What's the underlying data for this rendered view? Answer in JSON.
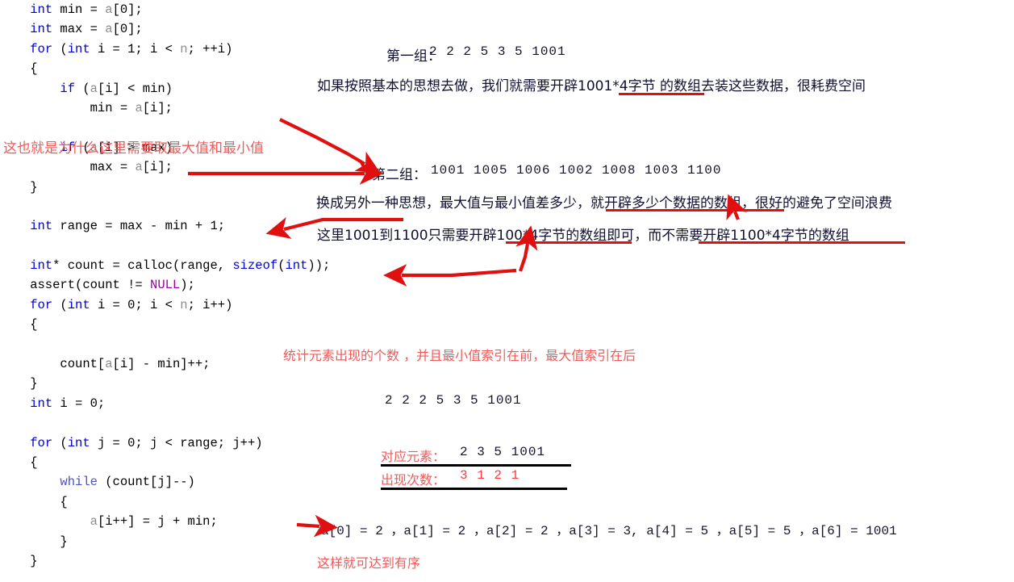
{
  "code": {
    "lines": [
      [
        {
          "t": "    ",
          "c": "plain"
        },
        {
          "t": "int",
          "c": "kw"
        },
        {
          "t": " min = ",
          "c": "plain"
        },
        {
          "t": "a",
          "c": "var"
        },
        {
          "t": "[0];",
          "c": "plain"
        }
      ],
      [
        {
          "t": "    ",
          "c": "plain"
        },
        {
          "t": "int",
          "c": "kw"
        },
        {
          "t": " max = ",
          "c": "plain"
        },
        {
          "t": "a",
          "c": "var"
        },
        {
          "t": "[0];",
          "c": "plain"
        }
      ],
      [
        {
          "t": "    ",
          "c": "plain"
        },
        {
          "t": "for",
          "c": "kw"
        },
        {
          "t": " (",
          "c": "plain"
        },
        {
          "t": "int",
          "c": "kw"
        },
        {
          "t": " i = 1; i < ",
          "c": "plain"
        },
        {
          "t": "n",
          "c": "var"
        },
        {
          "t": "; ++i)",
          "c": "plain"
        }
      ],
      [
        {
          "t": "    {",
          "c": "plain"
        }
      ],
      [
        {
          "t": "        ",
          "c": "plain"
        },
        {
          "t": "if",
          "c": "kw"
        },
        {
          "t": " (",
          "c": "plain"
        },
        {
          "t": "a",
          "c": "var"
        },
        {
          "t": "[i] < min)",
          "c": "plain"
        }
      ],
      [
        {
          "t": "            min = ",
          "c": "plain"
        },
        {
          "t": "a",
          "c": "var"
        },
        {
          "t": "[i];",
          "c": "plain"
        }
      ],
      [
        {
          "t": "",
          "c": "plain"
        }
      ],
      [
        {
          "t": "        ",
          "c": "plain"
        },
        {
          "t": "if",
          "c": "kw"
        },
        {
          "t": " (",
          "c": "plain"
        },
        {
          "t": "a",
          "c": "var"
        },
        {
          "t": "[i] > max)",
          "c": "plain"
        }
      ],
      [
        {
          "t": "            max = ",
          "c": "plain"
        },
        {
          "t": "a",
          "c": "var"
        },
        {
          "t": "[i];",
          "c": "plain"
        }
      ],
      [
        {
          "t": "    }",
          "c": "plain"
        }
      ],
      [
        {
          "t": "",
          "c": "plain"
        }
      ],
      [
        {
          "t": "    ",
          "c": "plain"
        },
        {
          "t": "int",
          "c": "kw"
        },
        {
          "t": " range = max - min + 1;",
          "c": "plain"
        }
      ],
      [
        {
          "t": "",
          "c": "plain"
        }
      ],
      [
        {
          "t": "    ",
          "c": "plain"
        },
        {
          "t": "int",
          "c": "kw"
        },
        {
          "t": "* count = calloc(range, ",
          "c": "plain"
        },
        {
          "t": "sizeof",
          "c": "kw"
        },
        {
          "t": "(",
          "c": "plain"
        },
        {
          "t": "int",
          "c": "kw"
        },
        {
          "t": "));",
          "c": "plain"
        }
      ],
      [
        {
          "t": "    assert(count != ",
          "c": "plain"
        },
        {
          "t": "NULL",
          "c": "nul"
        },
        {
          "t": ");",
          "c": "plain"
        }
      ],
      [
        {
          "t": "    ",
          "c": "plain"
        },
        {
          "t": "for",
          "c": "kw"
        },
        {
          "t": " (",
          "c": "plain"
        },
        {
          "t": "int",
          "c": "kw"
        },
        {
          "t": " i = 0; i < ",
          "c": "plain"
        },
        {
          "t": "n",
          "c": "var"
        },
        {
          "t": "; i++)",
          "c": "plain"
        }
      ],
      [
        {
          "t": "    {",
          "c": "plain"
        }
      ],
      [
        {
          "t": "",
          "c": "plain"
        }
      ],
      [
        {
          "t": "        count[",
          "c": "plain"
        },
        {
          "t": "a",
          "c": "var"
        },
        {
          "t": "[i] - min]++;",
          "c": "plain"
        }
      ],
      [
        {
          "t": "    }",
          "c": "plain"
        }
      ],
      [
        {
          "t": "    ",
          "c": "plain"
        },
        {
          "t": "int",
          "c": "kw"
        },
        {
          "t": " i = 0;",
          "c": "plain"
        }
      ],
      [
        {
          "t": "",
          "c": "plain"
        }
      ],
      [
        {
          "t": "    ",
          "c": "plain"
        },
        {
          "t": "for",
          "c": "kw"
        },
        {
          "t": " (",
          "c": "plain"
        },
        {
          "t": "int",
          "c": "kw"
        },
        {
          "t": " j = 0; j < range; j++)",
          "c": "plain"
        }
      ],
      [
        {
          "t": "    {",
          "c": "plain"
        }
      ],
      [
        {
          "t": "        ",
          "c": "plain"
        },
        {
          "t": "while",
          "c": "kw2"
        },
        {
          "t": " (count[j]--)",
          "c": "plain"
        }
      ],
      [
        {
          "t": "        {",
          "c": "plain"
        }
      ],
      [
        {
          "t": "            ",
          "c": "plain"
        },
        {
          "t": "a",
          "c": "var"
        },
        {
          "t": "[i++] = j + min;",
          "c": "plain"
        }
      ],
      [
        {
          "t": "        }",
          "c": "plain"
        }
      ],
      [
        {
          "t": "    }",
          "c": "plain"
        }
      ]
    ]
  },
  "annotations": {
    "minmax_note": "这也就是为什么这里需要取最大值和最小值",
    "group1_label": "第一组：",
    "group1_values": "2     2     2      5      3      5      1001",
    "group1_explain": "如果按照基本的思想去做，我们就需要开辟1001*4字节 的数组去装这些数据，很耗费空间",
    "group2_label": "第二组：",
    "group2_values": "1001    1005    1006    1002    1008    1003    1100",
    "group2_explain": "换成另外一种思想，最大值与最小值差多少，就开辟多少个数据的数组，很好的避免了空间浪费",
    "range_explain": "这里1001到1100只需要开辟100*4字节的数组即可，而不需要开辟1100*4字节的数组",
    "count_note": "统计元素出现的个数 ，并且最小值索引在前，最大值索引在后",
    "raw_array": "2     2     2      5      3      5      1001",
    "table_row1_label": "对应元素：",
    "table_row1_values": "2    3    5    1001",
    "table_row2_label": "出现次数：",
    "table_row2_values": "3    1    2     1",
    "result_line": "a[0] = 2 ，a[1] = 2 ，a[2] = 2 ，a[3] = 3, a[4] = 5 ，a[5] = 5 ，a[6] = 1001",
    "final_note": "这样就可达到有序"
  },
  "colors": {
    "annotation_red": "#f05a5a",
    "arrow_red": "#e11010",
    "keyword_blue": "#0000d2",
    "null_purple": "#a000a0",
    "variable_gray": "#8c8c8c"
  }
}
